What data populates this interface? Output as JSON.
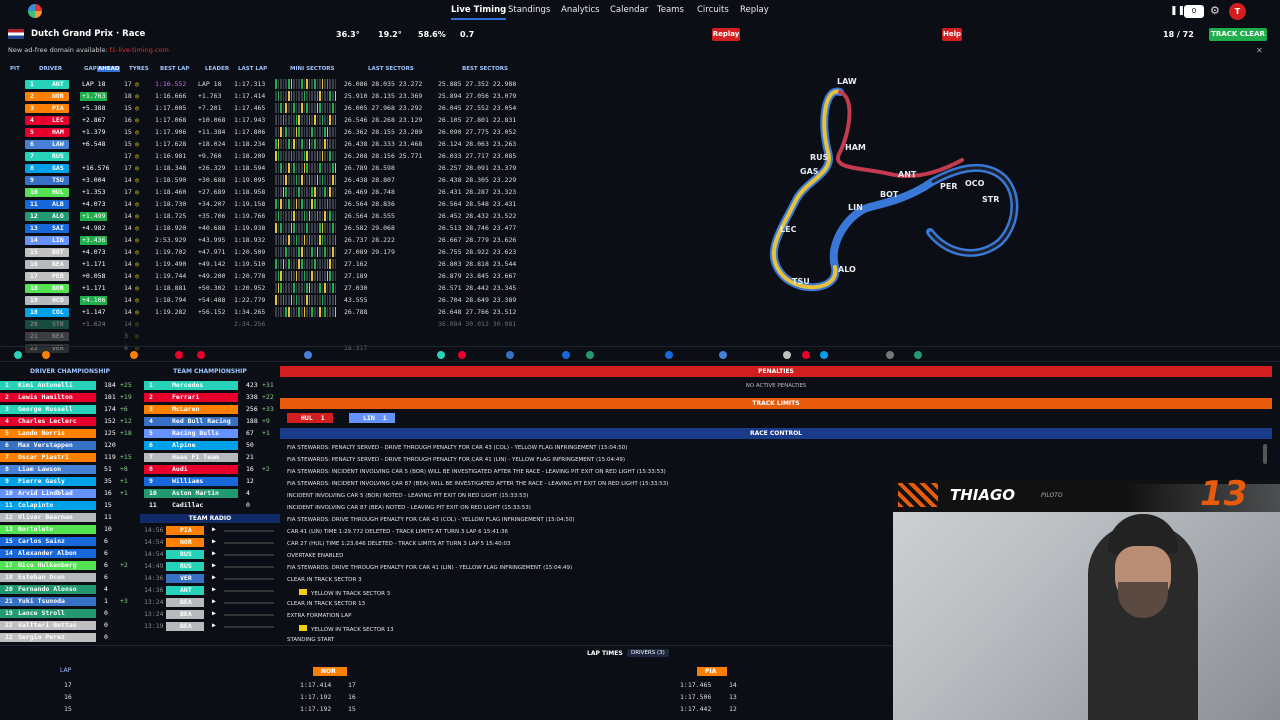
{
  "nav": {
    "items": [
      "Live Timing",
      "Standings",
      "Analytics",
      "Calendar",
      "Teams",
      "Circuits",
      "Replay"
    ],
    "active": "Live Timing",
    "counter": "0",
    "avatar": "T"
  },
  "session": {
    "name": "Dutch Grand Prix · Race",
    "air": "36.3°",
    "track": "19.2°",
    "humidity": "58.6%",
    "wind": "0.7",
    "replay_label": "Replay",
    "help_label": "Help",
    "laps": "18 / 72",
    "track_status": "TRACK CLEAR"
  },
  "notice": {
    "text": "New ad-free domain available:",
    "link": "f1-live-timing.com"
  },
  "table_headers": [
    "PIT",
    "DRIVER",
    "GAP",
    "AHEAD",
    "TYRES",
    "BEST LAP",
    "LEADER",
    "LAST LAP",
    "MINI SECTORS",
    "LAST SECTORS",
    "BEST SECTORS"
  ],
  "drivers": [
    {
      "pos": "1",
      "code": "ANT",
      "color": "#27d2b8",
      "gap": "LAP 18",
      "lapsAge": "17",
      "best": "1:16.552",
      "leader": "LAP 18",
      "last": "1:17.313",
      "s": "26.086 28.035 23.272",
      "b": "25.885 27.352 22.988"
    },
    {
      "pos": "2",
      "code": "NOR",
      "color": "#ff8000",
      "gap": "+1.763",
      "lapsAge": "18",
      "best": "1:16.666",
      "leader": "+1.763",
      "last": "1:17.414",
      "s": "25.910 28.135 23.369",
      "b": "25.894 27.056 23.079"
    },
    {
      "pos": "3",
      "code": "PIA",
      "color": "#ff8000",
      "gap": "+5.388",
      "lapsAge": "15",
      "best": "1:17.005",
      "leader": "+7.201",
      "last": "1:17.465",
      "s": "26.005 27.968 23.292",
      "b": "26.045 27.552 23.054"
    },
    {
      "pos": "4",
      "code": "LEC",
      "color": "#e8002d",
      "gap": "+2.867",
      "lapsAge": "16",
      "best": "1:17.068",
      "leader": "+10.068",
      "last": "1:17.943",
      "s": "26.546 28.268 23.129",
      "b": "26.105 27.801 22.831"
    },
    {
      "pos": "5",
      "code": "HAM",
      "color": "#e8002d",
      "gap": "+1.379",
      "lapsAge": "15",
      "best": "1:17.906",
      "leader": "+11.384",
      "last": "1:17.806",
      "s": "26.362 28.155 23.289",
      "b": "26.090 27.775 23.052"
    },
    {
      "pos": "6",
      "code": "LAW",
      "color": "#4781d7",
      "gap": "+6.548",
      "lapsAge": "15",
      "best": "1:17.628",
      "leader": "+18.024",
      "last": "1:18.234",
      "s": "26.438 28.333 23.468",
      "b": "26.124 28.063 23.263"
    },
    {
      "pos": "7",
      "code": "RUS",
      "color": "#27d2b8",
      "gap": "",
      "lapsAge": "17",
      "best": "1:16.981",
      "leader": "+9.760",
      "last": "1:18.209",
      "s": "26.208 28.156 25.771",
      "b": "26.033 27.717 23.085"
    },
    {
      "pos": "8",
      "code": "GAS",
      "color": "#00a1e8",
      "gap": "+16.576",
      "lapsAge": "17",
      "best": "1:18.348",
      "leader": "+26.329",
      "last": "1:18.594",
      "s": "26.789 28.598",
      "b": "26.257 28.091 23.379"
    },
    {
      "pos": "9",
      "code": "TSU",
      "color": "#3671c6",
      "gap": "+3.004",
      "lapsAge": "14",
      "best": "1:18.590",
      "leader": "+30.688",
      "last": "1:19.095",
      "s": "26.438 28.807",
      "b": "26.438 28.305 23.229"
    },
    {
      "pos": "10",
      "code": "HUL",
      "color": "#52e252",
      "gap": "+1.353",
      "lapsAge": "17",
      "best": "1:18.460",
      "leader": "+27.689",
      "last": "1:18.958",
      "s": "26.469 28.748",
      "b": "26.431 28.287 23.323"
    },
    {
      "pos": "11",
      "code": "ALB",
      "color": "#1868db",
      "gap": "+4.073",
      "lapsAge": "14",
      "best": "1:18.730",
      "leader": "+34.207",
      "last": "1:19.158",
      "s": "26.564 28.836",
      "b": "26.564 28.548 23.431"
    },
    {
      "pos": "12",
      "code": "ALO",
      "color": "#229971",
      "gap": "+1.499",
      "lapsAge": "14",
      "best": "1:18.725",
      "leader": "+35.706",
      "last": "1:19.766",
      "s": "26.564 28.555",
      "b": "26.452 28.432 23.522"
    },
    {
      "pos": "13",
      "code": "SAI",
      "color": "#1868db",
      "gap": "+4.982",
      "lapsAge": "14",
      "best": "1:18.920",
      "leader": "+40.688",
      "last": "1:19.938",
      "s": "26.582 29.068",
      "b": "26.513 28.746 23.477"
    },
    {
      "pos": "14",
      "code": "LIN",
      "color": "#6692ff",
      "gap": "+3.436",
      "lapsAge": "14",
      "best": "2:53.929",
      "leader": "+43.995",
      "last": "1:18.932",
      "s": "26.737 28.222",
      "b": "26.667 28.779 23.626"
    },
    {
      "pos": "15",
      "code": "BOT",
      "color": "#c0c0c0",
      "gap": "+4.073",
      "lapsAge": "14",
      "best": "1:19.702",
      "leader": "+47.971",
      "last": "1:20.509",
      "s": "27.089 29.179",
      "b": "26.755 28.922 23.623"
    },
    {
      "pos": "16",
      "code": "BEA",
      "color": "#b6babd",
      "gap": "+1.171",
      "lapsAge": "14",
      "best": "1:19.490",
      "leader": "+49.142",
      "last": "1:19.510",
      "s": "27.162",
      "b": "26.803 28.818 23.544"
    },
    {
      "pos": "17",
      "code": "PER",
      "color": "#c0c0c0",
      "gap": "+0.058",
      "lapsAge": "14",
      "best": "1:19.744",
      "leader": "+49.200",
      "last": "1:20.778",
      "s": "27.189",
      "b": "26.879 23.845 23.667"
    },
    {
      "pos": "18",
      "code": "BOR",
      "color": "#52e252",
      "gap": "+1.171",
      "lapsAge": "14",
      "best": "1:18.881",
      "leader": "+50.302",
      "last": "1:20.952",
      "s": "27.030",
      "b": "26.571 28.442 23.345"
    },
    {
      "pos": "19",
      "code": "OCO",
      "color": "#b6babd",
      "gap": "+4.106",
      "lapsAge": "14",
      "best": "1:18.794",
      "leader": "+54.488",
      "last": "1:22.779",
      "s": "43.555",
      "b": "26.704 28.649 23.389"
    },
    {
      "pos": "18",
      "code": "COL",
      "color": "#00a1e8",
      "gap": "+1.147",
      "lapsAge": "14",
      "best": "1:19.282",
      "leader": "+56.152",
      "last": "1:34.265",
      "s": "26.788",
      "b": "26.648 27.766 23.512"
    },
    {
      "pos": "20",
      "code": "STR",
      "color": "#229971",
      "gap": "+1.624",
      "lapsAge": "14",
      "best": "",
      "leader": "",
      "last": "2:34.256",
      "s": "",
      "b": "36.084 30.012 30.081"
    },
    {
      "pos": "21",
      "code": "BEA",
      "color": "#777",
      "gap": "",
      "lapsAge": "3",
      "best": "",
      "leader": "",
      "last": "",
      "s": "",
      "b": ""
    },
    {
      "pos": "22",
      "code": "VER",
      "color": "#555",
      "gap": "",
      "lapsAge": "0",
      "best": "",
      "leader": "",
      "last": "",
      "s": "28.317",
      "b": ""
    }
  ],
  "map": {
    "labels": [
      "LAW",
      "HAM",
      "RUS",
      "ANT",
      "GAS",
      "BOT",
      "PER",
      "OCO",
      "STR",
      "LIN",
      "TSU",
      "ALO",
      "LEC"
    ]
  },
  "driver_championship": {
    "title": "DRIVER CHAMPIONSHIP",
    "rows": [
      {
        "p": "1",
        "n": "Kimi Antonelli",
        "pts": "184",
        "d": "+25",
        "c": "#27d2b8"
      },
      {
        "p": "2",
        "n": "Lewis Hamilton",
        "pts": "181",
        "d": "+19",
        "c": "#e8002d"
      },
      {
        "p": "3",
        "n": "George Russell",
        "pts": "174",
        "d": "+6",
        "c": "#27d2b8"
      },
      {
        "p": "4",
        "n": "Charles Leclerc",
        "pts": "152",
        "d": "+12",
        "c": "#e8002d"
      },
      {
        "p": "5",
        "n": "Lando Norris",
        "pts": "125",
        "d": "+18",
        "c": "#ff8000"
      },
      {
        "p": "6",
        "n": "Max Verstappen",
        "pts": "120",
        "d": "",
        "c": "#3671c6"
      },
      {
        "p": "7",
        "n": "Oscar Piastri",
        "pts": "119",
        "d": "+15",
        "c": "#ff8000"
      },
      {
        "p": "8",
        "n": "Liam Lawson",
        "pts": "51",
        "d": "+8",
        "c": "#4781d7"
      },
      {
        "p": "9",
        "n": "Pierre Gasly",
        "pts": "35",
        "d": "+1",
        "c": "#00a1e8"
      },
      {
        "p": "10",
        "n": "Arvid Lindblad",
        "pts": "16",
        "d": "+1",
        "c": "#6692ff"
      },
      {
        "p": "11",
        "n": "Colapinto",
        "pts": "15",
        "d": "",
        "c": "#00a1e8"
      },
      {
        "p": "12",
        "n": "Oliver Bearman",
        "pts": "11",
        "d": "",
        "c": "#b6babd"
      },
      {
        "p": "13",
        "n": "Bortoleto",
        "pts": "10",
        "d": "",
        "c": "#52e252"
      },
      {
        "p": "15",
        "n": "Carlos Sainz",
        "pts": "6",
        "d": "",
        "c": "#1868db"
      },
      {
        "p": "14",
        "n": "Alexander Albon",
        "pts": "6",
        "d": "",
        "c": "#1868db"
      },
      {
        "p": "17",
        "n": "Nico Hulkenberg",
        "pts": "6",
        "d": "+2",
        "c": "#52e252"
      },
      {
        "p": "18",
        "n": "Esteban Ocon",
        "pts": "6",
        "d": "",
        "c": "#b6babd"
      },
      {
        "p": "20",
        "n": "Fernando Alonso",
        "pts": "4",
        "d": "",
        "c": "#229971"
      },
      {
        "p": "21",
        "n": "Yuki Tsunoda",
        "pts": "1",
        "d": "+3",
        "c": "#3671c6"
      },
      {
        "p": "19",
        "n": "Lance Stroll",
        "pts": "0",
        "d": "",
        "c": "#229971"
      },
      {
        "p": "22",
        "n": "Valtteri Bottas",
        "pts": "0",
        "d": "",
        "c": "#c0c0c0"
      },
      {
        "p": "22",
        "n": "Sergio Perez",
        "pts": "0",
        "d": "",
        "c": "#c0c0c0"
      }
    ]
  },
  "team_championship": {
    "title": "TEAM CHAMPIONSHIP",
    "rows": [
      {
        "p": "1",
        "n": "Mercedes",
        "pts": "423",
        "d": "+31",
        "c": "#27d2b8"
      },
      {
        "p": "2",
        "n": "Ferrari",
        "pts": "338",
        "d": "+22",
        "c": "#e8002d"
      },
      {
        "p": "3",
        "n": "McLaren",
        "pts": "256",
        "d": "+33",
        "c": "#ff8000"
      },
      {
        "p": "4",
        "n": "Red Bull Racing",
        "pts": "188",
        "d": "+9",
        "c": "#3671c6"
      },
      {
        "p": "5",
        "n": "Racing Bulls",
        "pts": "67",
        "d": "+1",
        "c": "#6692ff"
      },
      {
        "p": "6",
        "n": "Alpine",
        "pts": "50",
        "d": "",
        "c": "#00a1e8"
      },
      {
        "p": "7",
        "n": "Haas F1 Team",
        "pts": "21",
        "d": "",
        "c": "#b6babd"
      },
      {
        "p": "8",
        "n": "Audi",
        "pts": "16",
        "d": "+2",
        "c": "#e8002d"
      },
      {
        "p": "9",
        "n": "Williams",
        "pts": "12",
        "d": "",
        "c": "#1868db"
      },
      {
        "p": "10",
        "n": "Aston Martin",
        "pts": "4",
        "d": "",
        "c": "#229971"
      },
      {
        "p": "11",
        "n": "Cadillac",
        "pts": "0",
        "d": "",
        "c": "#fff"
      }
    ]
  },
  "team_radio": {
    "title": "TEAM RADIO",
    "rows": [
      {
        "t": "14:56",
        "c": "PIA",
        "col": "#ff8000"
      },
      {
        "t": "14:54",
        "c": "NOR",
        "col": "#ff8000"
      },
      {
        "t": "14:54",
        "c": "RUS",
        "col": "#27d2b8"
      },
      {
        "t": "14:49",
        "c": "RUS",
        "col": "#27d2b8"
      },
      {
        "t": "14:36",
        "c": "VER",
        "col": "#3671c6"
      },
      {
        "t": "14:36",
        "c": "ANT",
        "col": "#27d2b8"
      },
      {
        "t": "13:24",
        "c": "BEA",
        "col": "#b6babd"
      },
      {
        "t": "13:24",
        "c": "BEA",
        "col": "#b6babd"
      },
      {
        "t": "13:19",
        "c": "BEA",
        "col": "#b6babd"
      }
    ]
  },
  "penalties": {
    "title": "PENALTIES",
    "empty": "NO ACTIVE PENALTIES"
  },
  "track_limits": {
    "title": "TRACK LIMITS",
    "items": [
      {
        "code": "HUL",
        "count": "1",
        "color": "#d21e1e"
      },
      {
        "code": "LIN",
        "count": "1",
        "color": "#6692ff"
      }
    ]
  },
  "race_control": {
    "title": "RACE CONTROL",
    "messages": [
      "FIA STEWARDS: PENALTY SERVED - DRIVE THROUGH PENALTY FOR CAR 43 (COL) - YELLOW FLAG INFRINGEMENT (15:04:50)",
      "FIA STEWARDS: PENALTY SERVED - DRIVE THROUGH PENALTY FOR CAR 41 (LIN) - YELLOW FLAG INFRINGEMENT (15:04:49)",
      "FIA STEWARDS: INCIDENT INVOLVING CAR 5 (BOR) WILL BE INVESTIGATED AFTER THE RACE - LEAVING PIT EXIT ON RED LIGHT (15:33:53)",
      "FIA STEWARDS: INCIDENT INVOLVING CAR 87 (BEA) WILL BE INVESTIGATED AFTER THE RACE - LEAVING PIT EXIT ON RED LIGHT (15:33:53)",
      "INCIDENT INVOLVING CAR 5 (BOR) NOTED - LEAVING PIT EXIT ON RED LIGHT (15:33:53)",
      "INCIDENT INVOLVING CAR 87 (BEA) NOTED - LEAVING PIT EXIT ON RED LIGHT (15:33:53)",
      "FIA STEWARDS: DRIVE THROUGH PENALTY FOR CAR 43 (COL) - YELLOW FLAG INFRINGEMENT (15:04:50)",
      "CAR 41 (LIN) TIME 1:29.772 DELETED - TRACK LIMITS AT TURN 3 LAP 6 15:41:36",
      "CAR 27 (HUL) TIME 1:23.646 DELETED - TRACK LIMITS AT TURN 3 LAP 5 15:40:03",
      "OVERTAKE ENABLED",
      "FIA STEWARDS: DRIVE THROUGH PENALTY FOR CAR 41 (LIN) - YELLOW FLAG INFRINGEMENT (15:04:49)",
      "CLEAR IN TRACK SECTOR 3",
      "YELLOW IN TRACK SECTOR 3",
      "CLEAR IN TRACK SECTOR 13",
      "EXTRA FORMATION LAP",
      "YELLOW IN TRACK SECTOR 13",
      "STANDING START"
    ]
  },
  "lap_times": {
    "title": "LAP TIMES",
    "drivers_label": "DRIVERS (3)",
    "lap_header": "LAP",
    "left_code": "NOR",
    "right_code": "PIA",
    "rows": [
      {
        "lap": "17",
        "l": "1:17.414",
        "ln": "17",
        "r": "1:17.465",
        "rn": "14"
      },
      {
        "lap": "16",
        "l": "1:17.192",
        "ln": "16",
        "r": "1:17.506",
        "rn": "13"
      },
      {
        "lap": "15",
        "l": "1:17.192",
        "ln": "15",
        "r": "1:17.442",
        "rn": "12"
      }
    ]
  },
  "overlay": {
    "name": "THIAGO",
    "role": "PILOTO",
    "number": "13"
  }
}
